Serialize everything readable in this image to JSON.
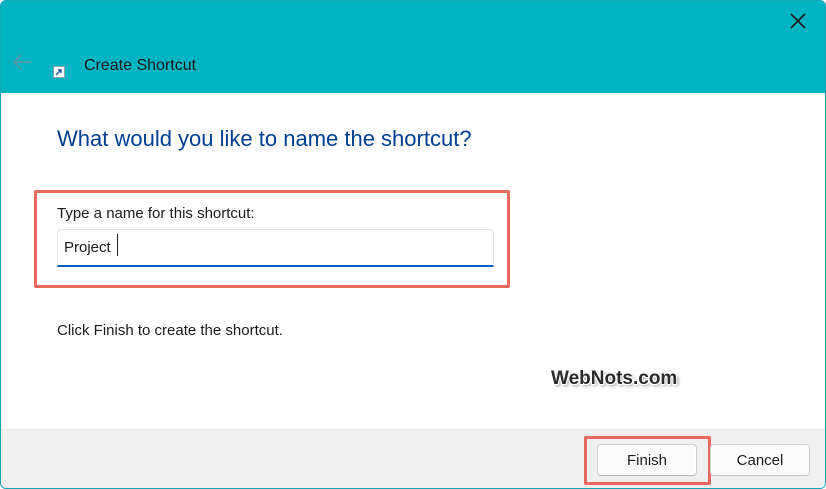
{
  "window": {
    "title": "Create Shortcut",
    "icons": {
      "close": "close-icon",
      "back": "back-arrow-icon",
      "app": "shortcut-icon"
    }
  },
  "main": {
    "heading": "What would you like to name the shortcut?",
    "field_label": "Type a name for this shortcut:",
    "field_value": "Project",
    "hint": "Click Finish to create the shortcut."
  },
  "watermark": "WebNots.com",
  "footer": {
    "finish_label": "Finish",
    "cancel_label": "Cancel"
  },
  "colors": {
    "titlebar": "#00b4c4",
    "heading": "#003e92",
    "highlight": "#e8695e",
    "input_underline": "#005fb8"
  }
}
